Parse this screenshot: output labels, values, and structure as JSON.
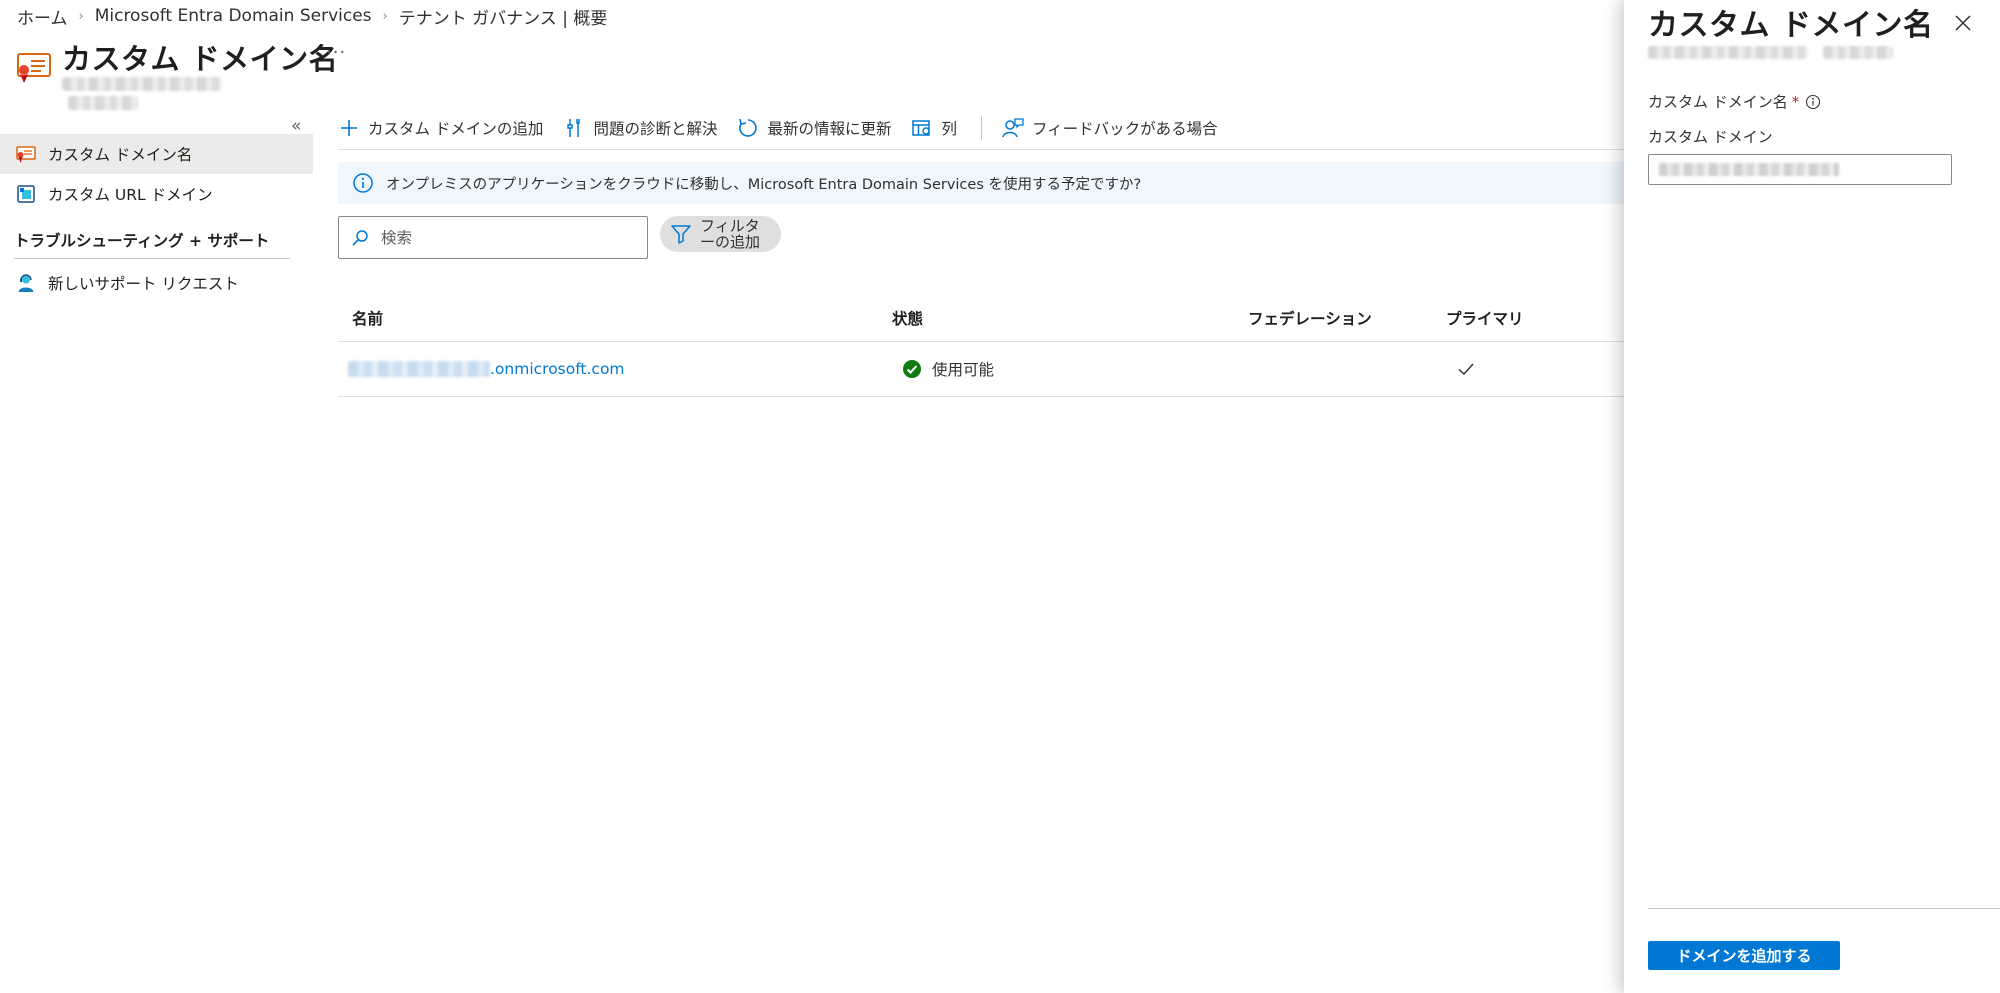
{
  "breadcrumb": {
    "items": [
      "ホーム",
      "Microsoft Entra Domain Services",
      "テナント ガバナンス | 概要"
    ],
    "separator": "›"
  },
  "header": {
    "title": "カスタム ドメイン名",
    "more_label": "···"
  },
  "nav": {
    "collapse_label": "«",
    "items": [
      {
        "label": "カスタム ドメイン名",
        "icon": "certificate-icon",
        "active": true
      },
      {
        "label": "カスタム URL ドメイン",
        "icon": "url-domain-icon",
        "active": false
      }
    ],
    "section_title": "トラブルシューティング + サポート",
    "support_items": [
      {
        "label": "新しいサポート リクエスト",
        "icon": "support-person-icon"
      }
    ]
  },
  "toolbar": {
    "add_domain": "カスタム ドメインの追加",
    "diagnose": "問題の診断と解決",
    "refresh": "最新の情報に更新",
    "columns": "列",
    "feedback": "フィードバックがある場合"
  },
  "banner": {
    "text": "オンプレミスのアプリケーションをクラウドに移動し、Microsoft Entra Domain Services を使用する予定ですか?"
  },
  "search": {
    "placeholder": "検索",
    "value": ""
  },
  "filter": {
    "label": "フィルターの追加"
  },
  "table": {
    "columns": [
      "名前",
      "状態",
      "フェデレーション",
      "プライマリ"
    ],
    "rows": [
      {
        "name_suffix": ".onmicrosoft.com",
        "status": "使用可能",
        "federation": "",
        "primary": true
      }
    ]
  },
  "panel": {
    "title": "カスタム ドメイン名",
    "field_label": "カスタム ドメイン名",
    "required_mark": "*",
    "field_sublabel": "カスタム ドメイン",
    "submit_label": "ドメインを追加する"
  },
  "colors": {
    "accent": "#0078d4",
    "success": "#107c10",
    "banner_bg": "#eff6fc",
    "nav_active_bg": "#edebe9"
  }
}
